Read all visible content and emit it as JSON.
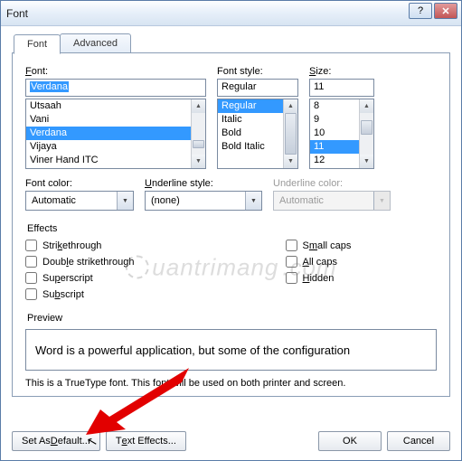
{
  "window": {
    "title": "Font"
  },
  "tabs": {
    "font": "Font",
    "advanced": "Advanced"
  },
  "font": {
    "label": "Font:",
    "value": "Verdana",
    "options": [
      "Utsaah",
      "Vani",
      "Verdana",
      "Vijaya",
      "Viner Hand ITC"
    ]
  },
  "fontstyle": {
    "label": "Font style:",
    "value": "Regular",
    "options": [
      "Regular",
      "Italic",
      "Bold",
      "Bold Italic"
    ]
  },
  "size": {
    "label": "Size:",
    "value": "11",
    "options": [
      "8",
      "9",
      "10",
      "11",
      "12"
    ]
  },
  "fontcolor": {
    "label": "Font color:",
    "value": "Automatic"
  },
  "underlinestyle": {
    "label": "Underline style:",
    "value": "(none)"
  },
  "underlinecolor": {
    "label": "Underline color:",
    "value": "Automatic"
  },
  "effects": {
    "label": "Effects",
    "strikethrough": "Strikethrough",
    "double_strike": "Double strikethrough",
    "superscript": "Superscript",
    "subscript": "Subscript",
    "smallcaps": "Small caps",
    "allcaps": "All caps",
    "hidden": "Hidden"
  },
  "preview": {
    "label": "Preview",
    "text": "Word is a powerful application, but some of the configuration"
  },
  "hint": "This is a TrueType font. This font will be used on both printer and screen.",
  "buttons": {
    "set_default": "Set As Default...",
    "text_effects": "Text Effects...",
    "ok": "OK",
    "cancel": "Cancel"
  },
  "watermark": "uantrimang"
}
